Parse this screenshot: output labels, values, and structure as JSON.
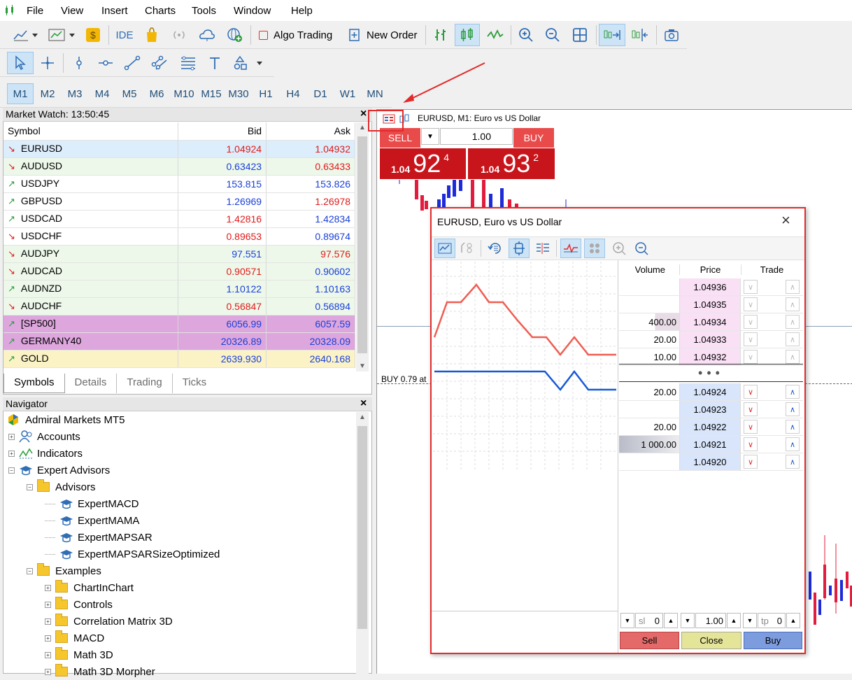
{
  "menu": [
    "File",
    "View",
    "Insert",
    "Charts",
    "Tools",
    "Window",
    "Help"
  ],
  "toolbar": {
    "ide": "IDE",
    "algo_trading": "Algo Trading",
    "new_order": "New Order"
  },
  "timeframes": [
    "M1",
    "M2",
    "M3",
    "M4",
    "M5",
    "M6",
    "M10",
    "M15",
    "M30",
    "H1",
    "H4",
    "D1",
    "W1",
    "MN"
  ],
  "market_watch": {
    "title": "Market Watch: 13:50:45",
    "columns": [
      "Symbol",
      "Bid",
      "Ask"
    ],
    "rows": [
      {
        "symbol": "EURUSD",
        "bid": "1.04924",
        "ask": "1.04932",
        "dir": "down",
        "bid_color": "#e01b1b",
        "ask_color": "#e01b1b",
        "bg": "#dceefc"
      },
      {
        "symbol": "AUDUSD",
        "bid": "0.63423",
        "ask": "0.63433",
        "dir": "down",
        "bid_color": "#1a3fd8",
        "ask_color": "#e01b1b",
        "bg": "#edf8ea"
      },
      {
        "symbol": "USDJPY",
        "bid": "153.815",
        "ask": "153.826",
        "dir": "up",
        "bid_color": "#1a3fd8",
        "ask_color": "#1a3fd8",
        "bg": "#ffffff"
      },
      {
        "symbol": "GBPUSD",
        "bid": "1.26969",
        "ask": "1.26978",
        "dir": "up",
        "bid_color": "#1a3fd8",
        "ask_color": "#e01b1b",
        "bg": "#ffffff"
      },
      {
        "symbol": "USDCAD",
        "bid": "1.42816",
        "ask": "1.42834",
        "dir": "up",
        "bid_color": "#e01b1b",
        "ask_color": "#1a3fd8",
        "bg": "#ffffff"
      },
      {
        "symbol": "USDCHF",
        "bid": "0.89653",
        "ask": "0.89674",
        "dir": "down",
        "bid_color": "#e01b1b",
        "ask_color": "#1a3fd8",
        "bg": "#ffffff"
      },
      {
        "symbol": "AUDJPY",
        "bid": "97.551",
        "ask": "97.576",
        "dir": "down",
        "bid_color": "#1a3fd8",
        "ask_color": "#e01b1b",
        "bg": "#edf8ea"
      },
      {
        "symbol": "AUDCAD",
        "bid": "0.90571",
        "ask": "0.90602",
        "dir": "down",
        "bid_color": "#e01b1b",
        "ask_color": "#1a3fd8",
        "bg": "#edf8ea"
      },
      {
        "symbol": "AUDNZD",
        "bid": "1.10122",
        "ask": "1.10163",
        "dir": "up",
        "bid_color": "#1a3fd8",
        "ask_color": "#1a3fd8",
        "bg": "#edf8ea"
      },
      {
        "symbol": "AUDCHF",
        "bid": "0.56847",
        "ask": "0.56894",
        "dir": "down",
        "bid_color": "#e01b1b",
        "ask_color": "#1a3fd8",
        "bg": "#edf8ea"
      },
      {
        "symbol": "[SP500]",
        "bid": "6056.99",
        "ask": "6057.59",
        "dir": "up",
        "bid_color": "#1a3fd8",
        "ask_color": "#1a3fd8",
        "bg": "#dda6dd"
      },
      {
        "symbol": "GERMANY40",
        "bid": "20326.89",
        "ask": "20328.09",
        "dir": "up",
        "bid_color": "#1a3fd8",
        "ask_color": "#1a3fd8",
        "bg": "#dda6dd"
      },
      {
        "symbol": "GOLD",
        "bid": "2639.930",
        "ask": "2640.168",
        "dir": "up",
        "bid_color": "#1a3fd8",
        "ask_color": "#1a3fd8",
        "bg": "#fbf3c6"
      }
    ],
    "tabs": [
      "Symbols",
      "Details",
      "Trading",
      "Ticks"
    ]
  },
  "navigator": {
    "title": "Navigator",
    "root": "Admiral Markets MT5",
    "items": [
      {
        "label": "Accounts",
        "level": 1,
        "icon": "accounts-icon",
        "pm": "+"
      },
      {
        "label": "Indicators",
        "level": 1,
        "icon": "indicators-icon",
        "pm": "+"
      },
      {
        "label": "Expert Advisors",
        "level": 1,
        "icon": "expert-advisors-icon",
        "pm": "-"
      },
      {
        "label": "Advisors",
        "level": 2,
        "icon": "folder-icon",
        "pm": "-"
      },
      {
        "label": "ExpertMACD",
        "level": 3,
        "icon": "expert-icon",
        "pm": ""
      },
      {
        "label": "ExpertMAMA",
        "level": 3,
        "icon": "expert-icon",
        "pm": ""
      },
      {
        "label": "ExpertMAPSAR",
        "level": 3,
        "icon": "expert-icon",
        "pm": ""
      },
      {
        "label": "ExpertMAPSARSizeOptimized",
        "level": 3,
        "icon": "expert-icon",
        "pm": ""
      },
      {
        "label": "Examples",
        "level": 2,
        "icon": "folder-icon",
        "pm": "-"
      },
      {
        "label": "ChartInChart",
        "level": 3,
        "icon": "folder-icon",
        "pm": "+"
      },
      {
        "label": "Controls",
        "level": 3,
        "icon": "folder-icon",
        "pm": "+"
      },
      {
        "label": "Correlation Matrix 3D",
        "level": 3,
        "icon": "folder-icon",
        "pm": "+"
      },
      {
        "label": "MACD",
        "level": 3,
        "icon": "folder-icon",
        "pm": "+"
      },
      {
        "label": "Math 3D",
        "level": 3,
        "icon": "folder-icon",
        "pm": "+"
      },
      {
        "label": "Math 3D Morpher",
        "level": 3,
        "icon": "folder-icon",
        "pm": "+"
      }
    ]
  },
  "chart": {
    "title": "EURUSD, M1:  Euro vs US Dollar",
    "sell_label": "SELL",
    "buy_label": "BUY",
    "volume": "1.00",
    "sell_prefix": "1.04",
    "sell_big": "92",
    "sell_sup": "4",
    "buy_prefix": "1.04",
    "buy_big": "93",
    "buy_sup": "2",
    "buy_line_label": "BUY 0.79 at"
  },
  "dom": {
    "title": "EURUSD, Euro vs US Dollar",
    "columns": [
      "Volume",
      "Price",
      "Trade"
    ],
    "asks": [
      {
        "volume": "",
        "price": "1.04936"
      },
      {
        "volume": "",
        "price": "1.04935"
      },
      {
        "volume": "400.00",
        "price": "1.04934"
      },
      {
        "volume": "20.00",
        "price": "1.04933"
      },
      {
        "volume": "10.00",
        "price": "1.04932"
      }
    ],
    "bids": [
      {
        "volume": "20.00",
        "price": "1.04924"
      },
      {
        "volume": "",
        "price": "1.04923"
      },
      {
        "volume": "20.00",
        "price": "1.04922"
      },
      {
        "volume": "1 000.00",
        "price": "1.04921"
      },
      {
        "volume": "",
        "price": "1.04920"
      }
    ],
    "sl_label": "sl",
    "sl_value": "0",
    "volume": "1.00",
    "tp_label": "tp",
    "tp_value": "0",
    "sell": "Sell",
    "close": "Close",
    "buy": "Buy",
    "colors": {
      "ask_price_bg": "#f9e0f5",
      "bid_price_bg": "#d8e5fa",
      "sell_btn": "#e46a6a",
      "close_btn": "#e5e59a",
      "buy_btn": "#7d9cde"
    }
  }
}
